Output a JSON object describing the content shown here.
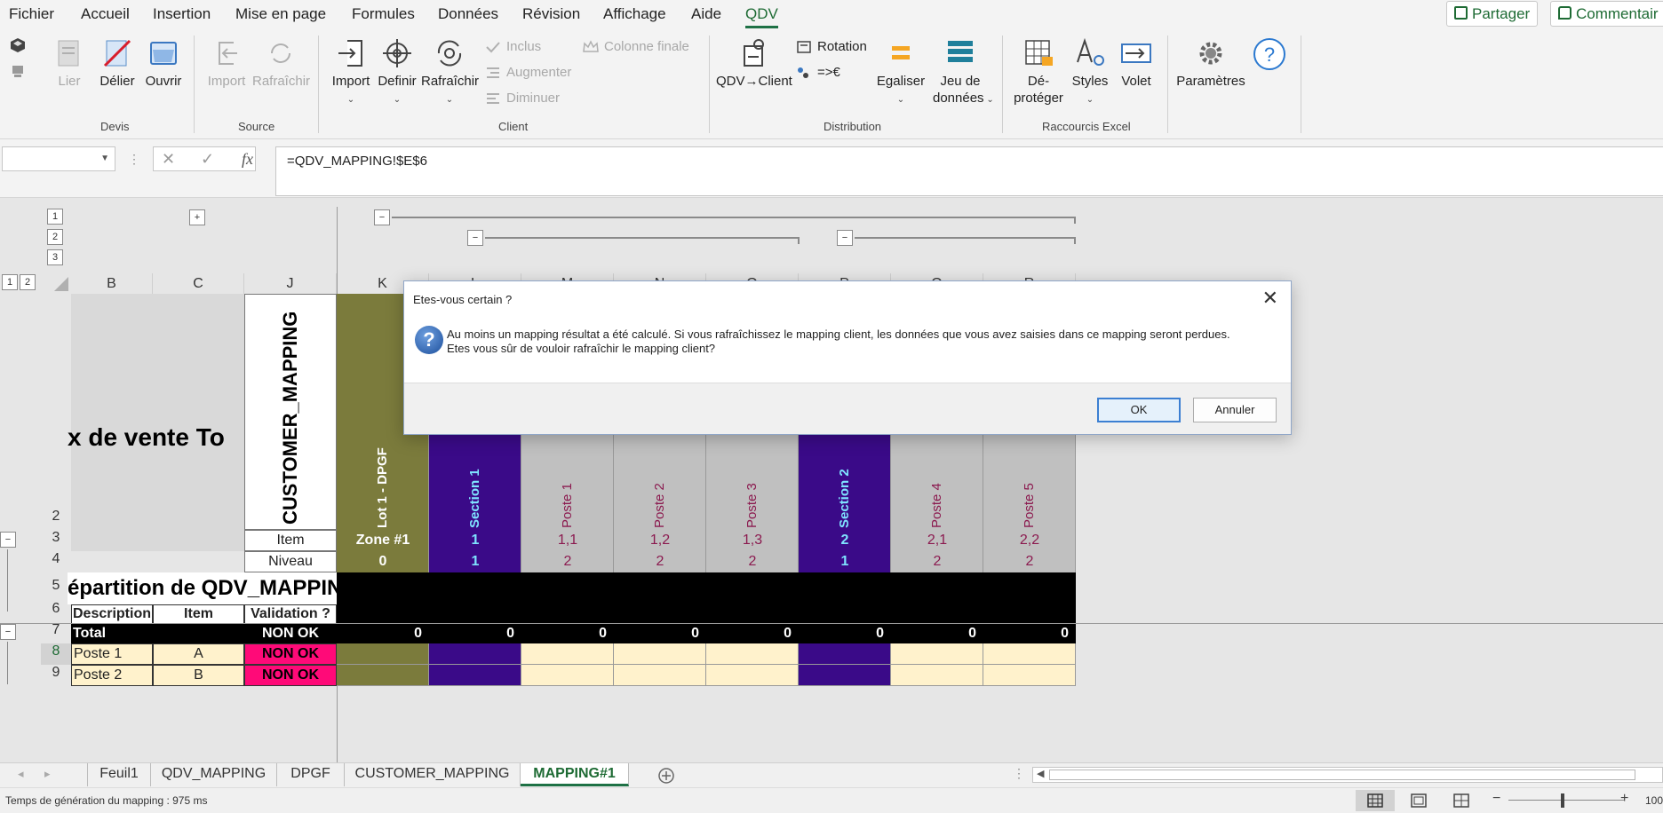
{
  "menu": {
    "items": [
      "Fichier",
      "Accueil",
      "Insertion",
      "Mise en page",
      "Formules",
      "Données",
      "Révision",
      "Affichage",
      "Aide",
      "QDV"
    ],
    "active": "QDV",
    "share_label": "Partager",
    "comment_label": "Commentair"
  },
  "ribbon": {
    "devis": {
      "label": "Devis",
      "lier": "Lier",
      "delier": "Délier",
      "ouvrir": "Ouvrir"
    },
    "source": {
      "label": "Source",
      "import": "Import",
      "rafraichir": "Rafraîchir"
    },
    "client": {
      "label": "Client",
      "import": "Import",
      "definir": "Definir",
      "rafraichir": "Rafraîchir",
      "inclus": "Inclus",
      "augmenter": "Augmenter",
      "diminuer": "Diminuer",
      "colonne_finale": "Colonne finale"
    },
    "distribution": {
      "label": "Distribution",
      "qdv_client": "QDV→Client",
      "rotation": "Rotation",
      "euro": "=>€",
      "egaliser": "Egaliser",
      "jeu_de": "Jeu de",
      "donnees": "données"
    },
    "raccourcis": {
      "label": "Raccourcis Excel",
      "deproteger_1": "Dé-",
      "deproteger_2": "protéger",
      "styles": "Styles",
      "volet": "Volet"
    },
    "parametres": "Paramètres"
  },
  "formula_bar": {
    "name_box": "",
    "formula": "=QDV_MAPPING!$E$6",
    "fx": "fx"
  },
  "outline": {
    "levels_rows": [
      "1",
      "2",
      "3"
    ],
    "levels_cols": [
      "1",
      "2"
    ],
    "plus": "+",
    "minus": "−"
  },
  "columns": [
    "B",
    "C",
    "J",
    "K",
    "L",
    "M",
    "N",
    "O",
    "P",
    "Q",
    "R"
  ],
  "rows": [
    "2",
    "3",
    "4",
    "5",
    "6",
    "7",
    "8",
    "9"
  ],
  "sheet": {
    "big_title": "x de vente To",
    "customer_mapping": "CUSTOMER_MAPPING",
    "item_label": "Item",
    "niveau_label": "Niveau",
    "repartition": "épartition de QDV_MAPPIN",
    "headers": {
      "description": "Description",
      "item": "Item",
      "validation": "Validation ?"
    },
    "total_label": "Total",
    "total_status": "NON OK",
    "lines": [
      {
        "description": "Poste 1",
        "item": "A",
        "validation": "NON OK"
      },
      {
        "description": "Poste 2",
        "item": "B",
        "validation": "NON OK"
      }
    ],
    "mapping_cols": [
      {
        "name": "Lot 1 - DPGF",
        "item": "Zone #1",
        "niveau": "0",
        "total": "0",
        "kind": "lot"
      },
      {
        "name": "Section 1",
        "item": "1",
        "niveau": "1",
        "total": "0",
        "kind": "section"
      },
      {
        "name": "Poste 1",
        "item": "1,1",
        "niveau": "2",
        "total": "0",
        "kind": "poste"
      },
      {
        "name": "Poste 2",
        "item": "1,2",
        "niveau": "2",
        "total": "0",
        "kind": "poste"
      },
      {
        "name": "Poste 3",
        "item": "1,3",
        "niveau": "2",
        "total": "0",
        "kind": "poste"
      },
      {
        "name": "Section 2",
        "item": "2",
        "niveau": "1",
        "total": "0",
        "kind": "section"
      },
      {
        "name": "Poste 4",
        "item": "2,1",
        "niveau": "2",
        "total": "0",
        "kind": "poste"
      },
      {
        "name": "Poste 5",
        "item": "2,2",
        "niveau": "2",
        "total": "0",
        "kind": "poste"
      }
    ]
  },
  "dialog": {
    "title": "Etes-vous certain ?",
    "line1": "Au moins un mapping résultat a été calculé. Si vous rafraîchissez le mapping client, les données que vous avez saisies dans ce mapping seront perdues.",
    "line2": "Etes vous sûr de vouloir rafraîchir le mapping client?",
    "ok": "OK",
    "cancel": "Annuler"
  },
  "tabs": [
    "Feuil1",
    "QDV_MAPPING",
    "DPGF",
    "CUSTOMER_MAPPING",
    "MAPPING#1"
  ],
  "active_tab": "MAPPING#1",
  "status": {
    "text": "Temps de génération du mapping : 975 ms",
    "zoom": "100"
  },
  "colors": {
    "accent": "#1e7145",
    "lot": "#7b7b3c",
    "section": "#3a0a88",
    "poste_text": "#8b1a4f",
    "item_light": "#fff2cc",
    "nonok": "#ff0a78",
    "black": "#000000",
    "title_gray": "#d9d9d9"
  }
}
